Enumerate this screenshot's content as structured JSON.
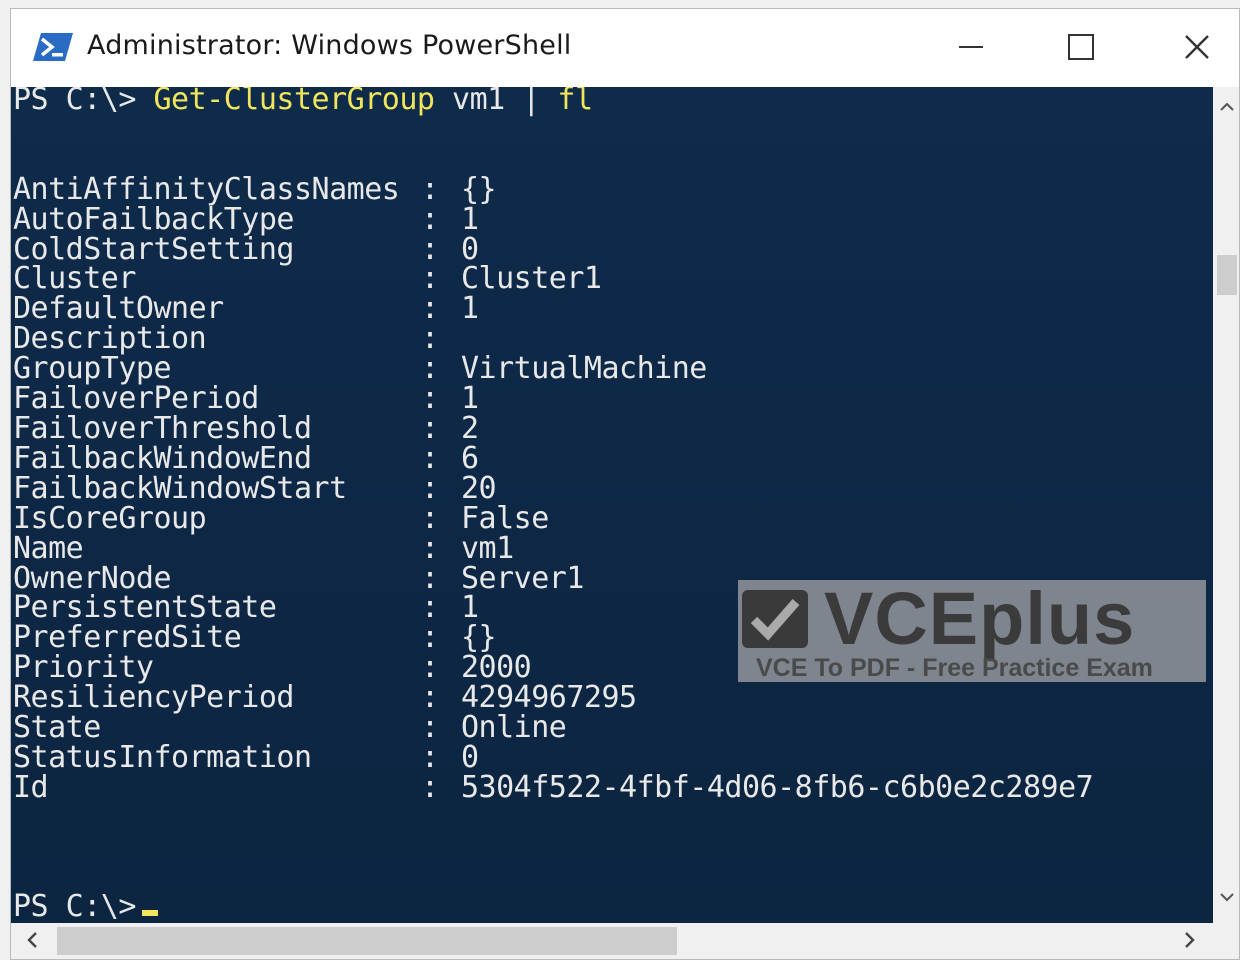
{
  "window": {
    "title": "Administrator: Windows PowerShell",
    "icon": "powershell-icon",
    "controls": {
      "minimize": "minimize-icon",
      "maximize": "maximize-icon",
      "close": "close-icon"
    }
  },
  "console": {
    "prompt": "PS C:\\>",
    "command": "Get-ClusterGroup",
    "command_arg": "vm1",
    "pipe": "|",
    "command_param": "fl",
    "properties": [
      {
        "key": "AntiAffinityClassNames",
        "value": "{}"
      },
      {
        "key": "AutoFailbackType",
        "value": "1"
      },
      {
        "key": "ColdStartSetting",
        "value": "0"
      },
      {
        "key": "Cluster",
        "value": "Cluster1"
      },
      {
        "key": "DefaultOwner",
        "value": "1"
      },
      {
        "key": "Description",
        "value": ""
      },
      {
        "key": "GroupType",
        "value": "VirtualMachine"
      },
      {
        "key": "FailoverPeriod",
        "value": "1"
      },
      {
        "key": "FailoverThreshold",
        "value": "2"
      },
      {
        "key": "FailbackWindowEnd",
        "value": "6"
      },
      {
        "key": "FailbackWindowStart",
        "value": "20"
      },
      {
        "key": "IsCoreGroup",
        "value": "False"
      },
      {
        "key": "Name",
        "value": "vm1"
      },
      {
        "key": "OwnerNode",
        "value": "Server1"
      },
      {
        "key": "PersistentState",
        "value": "1"
      },
      {
        "key": "PreferredSite",
        "value": "{}"
      },
      {
        "key": "Priority",
        "value": "2000"
      },
      {
        "key": "ResiliencyPeriod",
        "value": "4294967295"
      },
      {
        "key": "State",
        "value": "Online"
      },
      {
        "key": "StatusInformation",
        "value": "0"
      },
      {
        "key": "Id",
        "value": "5304f522-4fbf-4d06-8fb6-c6b0e2c289e7"
      }
    ],
    "separator": ":",
    "final_prompt": "PS C:\\>"
  },
  "watermark": {
    "brand": "VCEplus",
    "tagline": "VCE To PDF - Free Practice Exam"
  },
  "scrollbars": {
    "up_icon": "chevron-up-icon",
    "down_icon": "chevron-down-icon",
    "left_icon": "chevron-left-icon",
    "right_icon": "chevron-right-icon"
  },
  "colors": {
    "console_bg": "#0f2a48",
    "console_text": "#e8e8e8",
    "command_text": "#f2e55c",
    "powershell_icon": "#2a6bc4"
  }
}
